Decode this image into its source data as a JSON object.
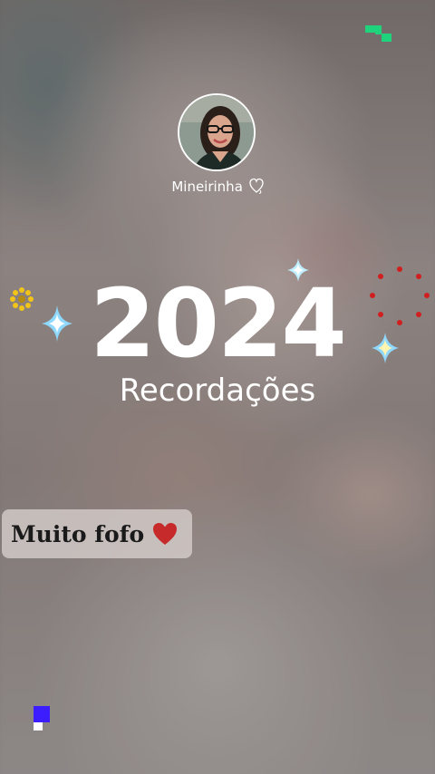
{
  "story": {
    "username": "Mineirinha",
    "year": "2024",
    "subtitle": "Recordações",
    "caption": "Muito fofo"
  },
  "icons": {
    "heart_outline": "heart-outline-icon",
    "heart_filled": "heart-icon",
    "sparkle": "sparkle-icon",
    "flower": "flower-icon"
  },
  "colors": {
    "text": "#ffffff",
    "caption_text": "#1a1a1a",
    "heart_red": "#c62a2a",
    "sparkle_blue": "#8fd8ff",
    "ring_red": "#d01f1f",
    "flower_yellow": "#f2c418",
    "pixel_green": "#1ed37c",
    "pixel_blue": "#3b1dff"
  }
}
